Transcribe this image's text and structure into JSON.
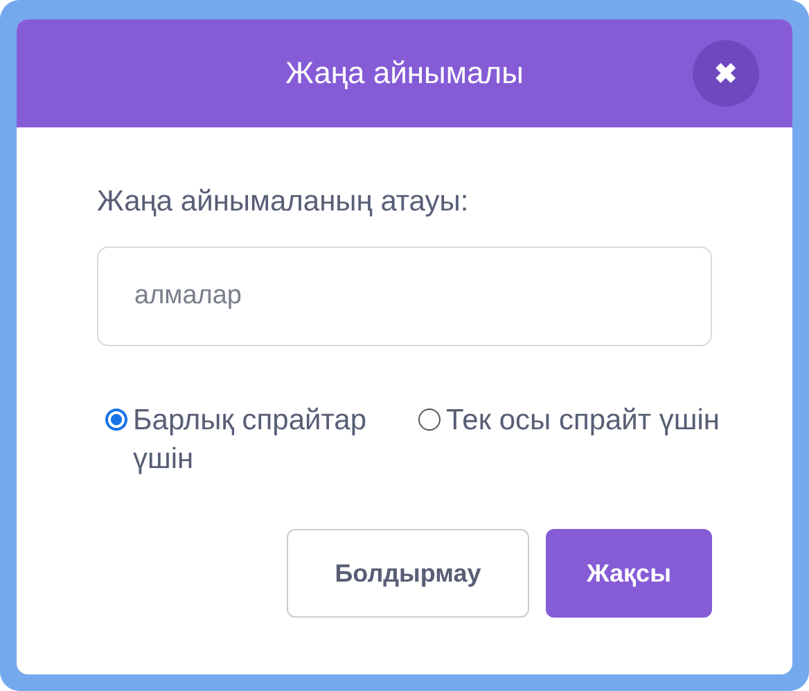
{
  "dialog": {
    "title": "Жаңа айнымалы",
    "close": "✖"
  },
  "field": {
    "label": "Жаңа айнымаланың атауы:",
    "value": "алмалар"
  },
  "options": [
    {
      "label": "Барлық спрайтар үшін",
      "selected": true
    },
    {
      "label": "Тек осы спрайт үшін",
      "selected": false
    }
  ],
  "buttons": [
    {
      "label": "Болдырмау",
      "kind": "secondary"
    },
    {
      "label": "Жақсы",
      "kind": "primary"
    }
  ]
}
